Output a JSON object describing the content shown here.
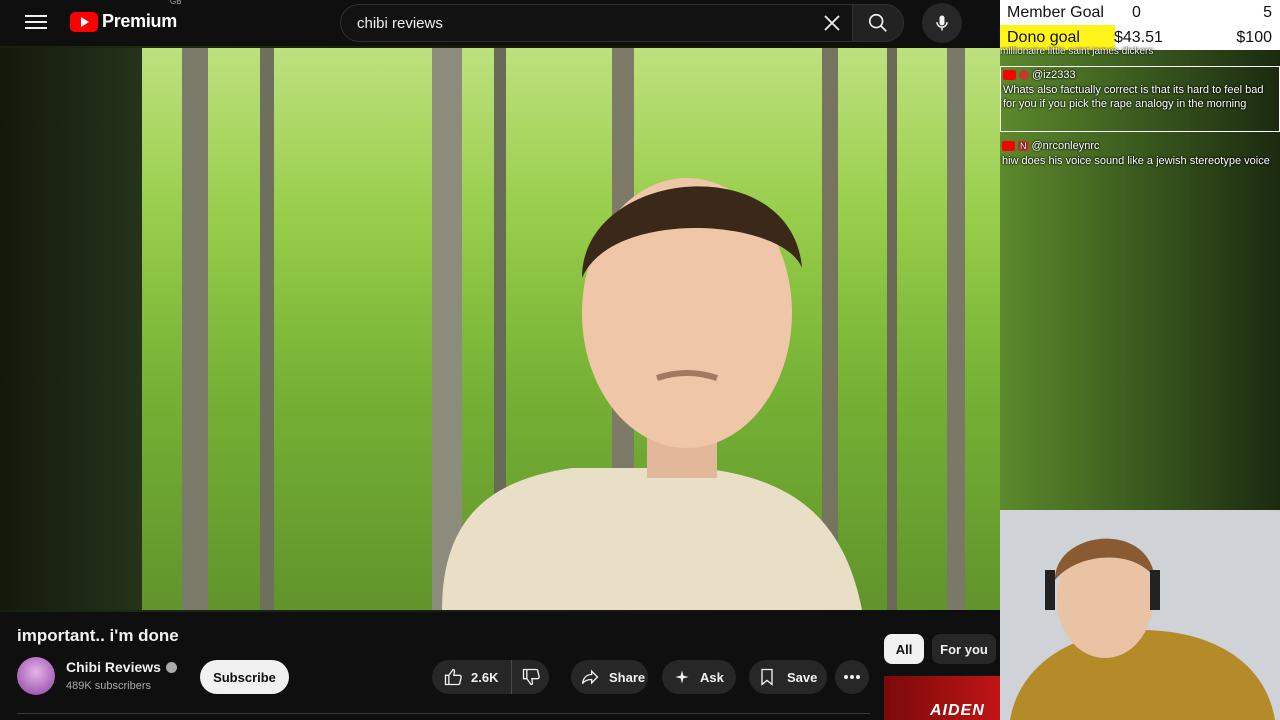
{
  "header": {
    "logo_text": "Premium",
    "logo_region": "GB",
    "search_value": "chibi reviews"
  },
  "overlay": {
    "member_goal": {
      "label": "Member Goal",
      "current": "0",
      "target": "5"
    },
    "dono_goal": {
      "label": "Dono goal",
      "current": "$43.51",
      "target": "$100",
      "progress_fraction": 0.4351
    },
    "chat": [
      {
        "cut_text": "millionaire little saint james dickers"
      },
      {
        "username": "@iz2333",
        "text": "Whats also factually correct is that its hard to feel bad for you if you pick the rape analogy in the morning"
      },
      {
        "username": "@nrconleynrc",
        "badge": "N",
        "text": "hiw does his voice sound like a jewish stereotype voice"
      }
    ]
  },
  "video": {
    "title": "important.. i'm done"
  },
  "channel": {
    "name": "Chibi Reviews",
    "subscribers": "489K subscribers",
    "subscribe_label": "Subscribe"
  },
  "actions": {
    "likes": "2.6K",
    "share": "Share",
    "ask": "Ask",
    "save": "Save"
  },
  "chips": [
    "All",
    "For you"
  ],
  "thumbnail_text": "AIDEN"
}
